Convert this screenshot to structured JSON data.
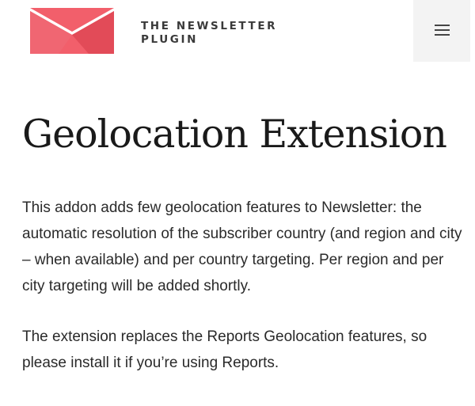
{
  "header": {
    "brand_line1": "THE NEWSLETTER",
    "brand_line2": "PLUGIN",
    "logo_icon": "envelope-logo-icon",
    "menu_icon": "hamburger-menu-icon",
    "colors": {
      "logo_primary": "#f25f6b",
      "logo_shade": "#e24b58",
      "menu_background": "#f3f3f3"
    }
  },
  "main": {
    "title": "Geolocation Extension",
    "paragraphs": [
      "This addon adds few geolocation features to Newsletter: the automatic resolution of the subscriber country (and region and city – when available) and per country targeting. Per region and per city targeting will be added shortly.",
      "The extension replaces the Reports Geolocation features, so please install it if you’re using Reports."
    ]
  }
}
